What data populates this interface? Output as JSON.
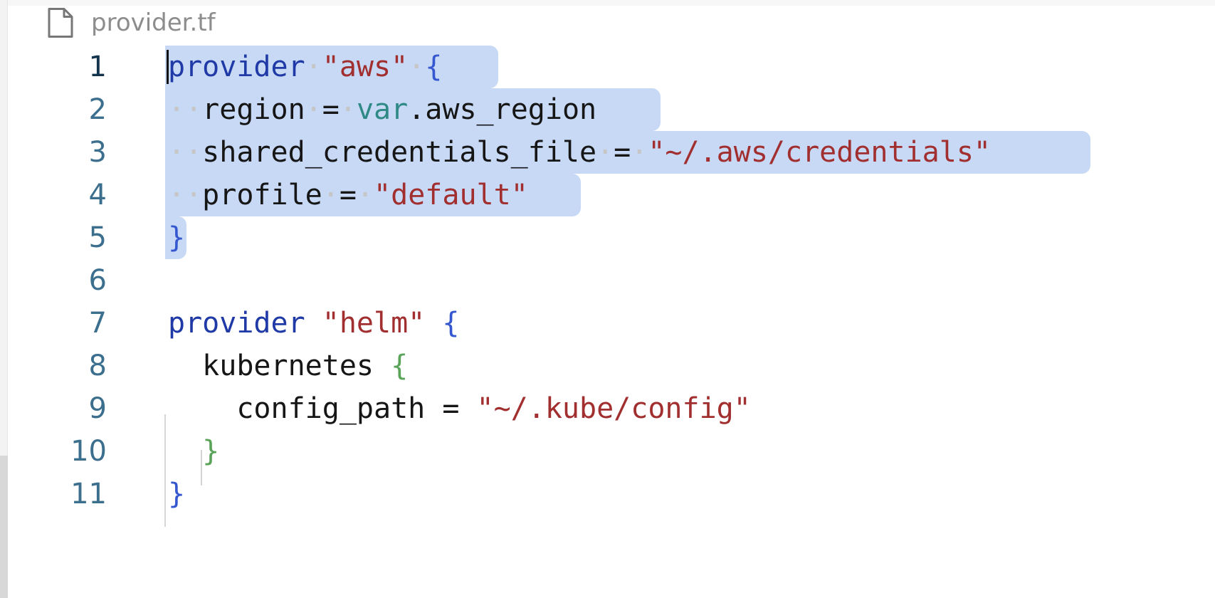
{
  "tab": {
    "filename": "provider.tf",
    "icon": "file-icon"
  },
  "editor": {
    "line_numbers": [
      "1",
      "2",
      "3",
      "4",
      "5",
      "6",
      "7",
      "8",
      "9",
      "10",
      "11"
    ],
    "code": {
      "l1_kw": "provider",
      "l1_str": "\"aws\"",
      "l1_brace": "{",
      "l2_ident": "region",
      "l2_eq": "=",
      "l2_var": "var",
      "l2_rest": ".aws_region",
      "l3_ident": "shared_credentials_file",
      "l3_eq": "=",
      "l3_str": "\"~/.aws/credentials\"",
      "l4_ident": "profile",
      "l4_eq": "=",
      "l4_str": "\"default\"",
      "l5_brace": "}",
      "l7_kw": "provider",
      "l7_str": "\"helm\"",
      "l7_brace": "{",
      "l8_ident": "kubernetes",
      "l8_brace": "{",
      "l9_ident": "config_path",
      "l9_eq": "=",
      "l9_str": "\"~/.kube/config\"",
      "l10_brace": "}",
      "l11_brace": "}"
    },
    "selection_color": "#c7d9f5"
  },
  "colors": {
    "keyword": "#1f3aa6",
    "string": "#a22f2f",
    "variable": "#2f8a86",
    "line_number": "#3b6f8d",
    "brace_outer": "#3558d0",
    "brace_inner": "#5aa45a"
  }
}
